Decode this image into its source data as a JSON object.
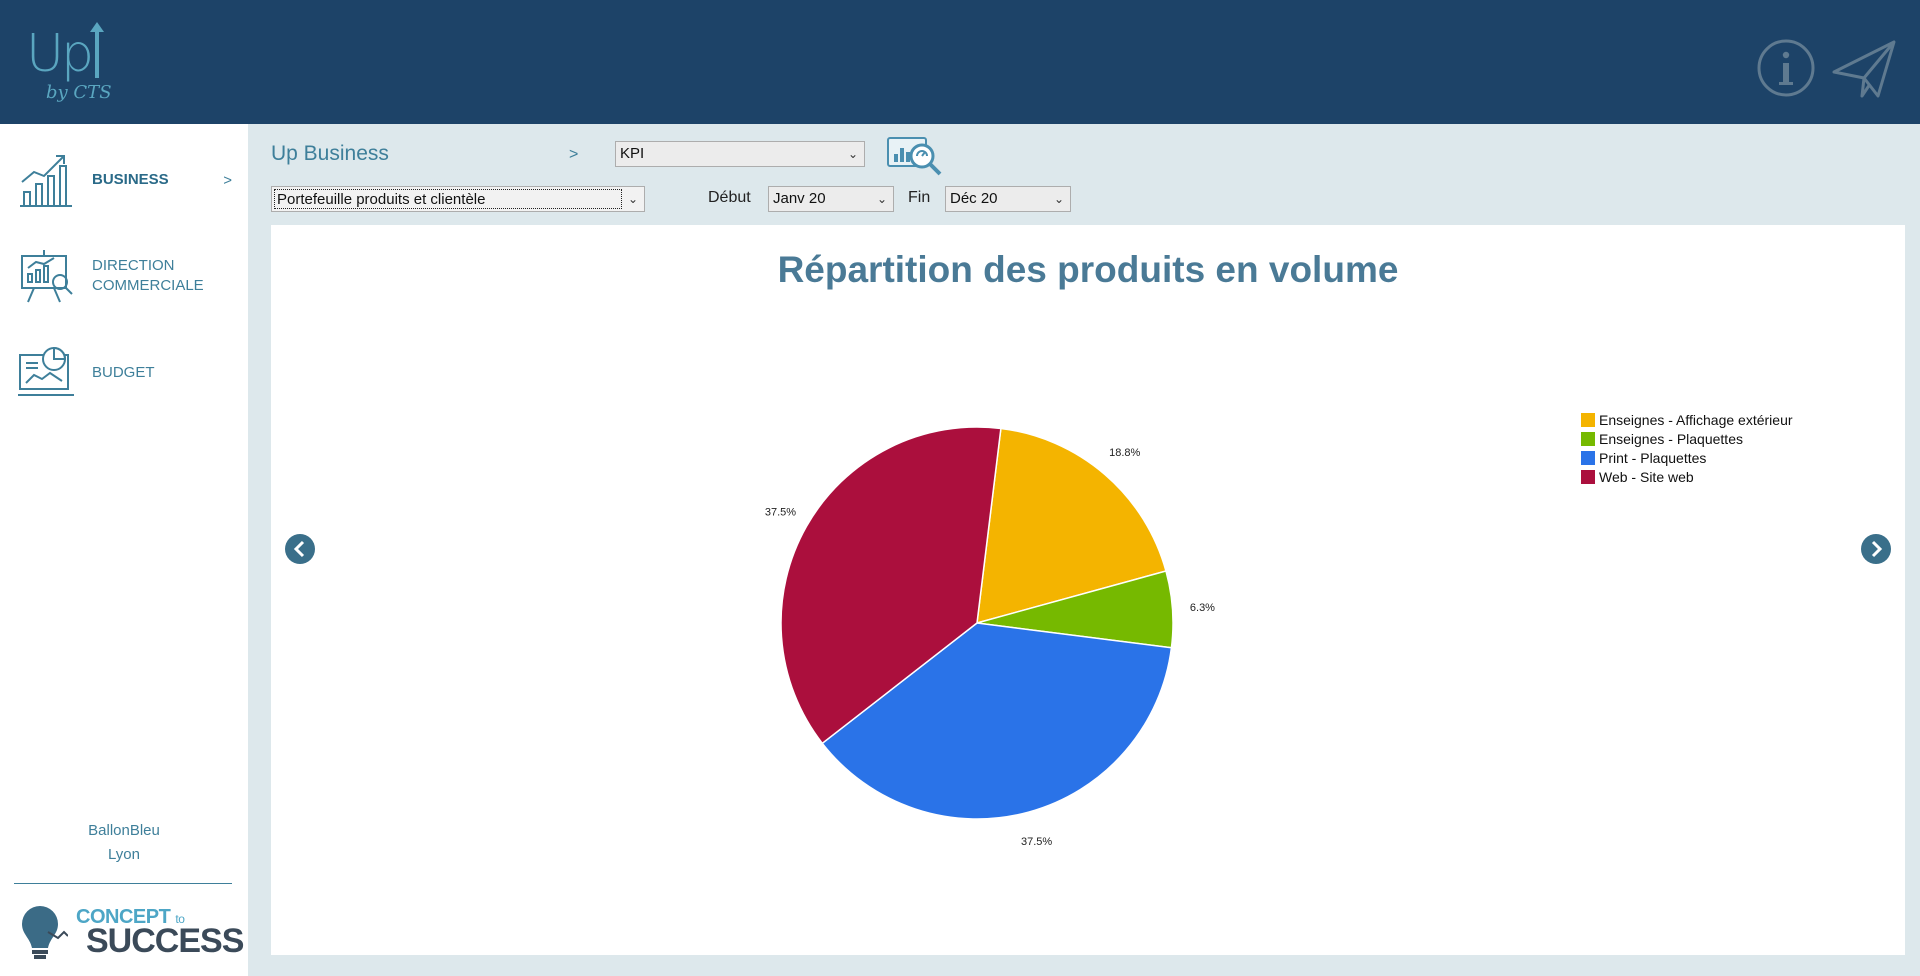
{
  "header": {
    "logo_text": "Up",
    "logo_sub": "by CTS",
    "info_icon": "info-icon",
    "send_icon": "paper-plane-icon"
  },
  "sidebar": {
    "items": [
      {
        "label": "BUSINESS",
        "icon": "line-chart-icon",
        "active": true,
        "chevron": ">"
      },
      {
        "label": "DIRECTION\nCOMMERCIALE",
        "icon": "presentation-analytics-icon",
        "active": false
      },
      {
        "label": "BUDGET",
        "icon": "dashboard-budget-icon",
        "active": false
      }
    ],
    "company_name": "BallonBleu",
    "company_city": "Lyon",
    "footer_logo_line1": "CONCEPT",
    "footer_logo_to": "to",
    "footer_logo_line2": "SUCCESS"
  },
  "toolbar": {
    "breadcrumb": "Up Business",
    "breadcrumb_sep": ">",
    "kpi_select": "KPI",
    "report_select": "Portefeuille produits et clientèle",
    "start_label": "Début",
    "start_value": "Janv 20",
    "end_label": "Fin",
    "end_value": "Déc 20",
    "kpi_button_icon": "magnifier-chart-icon"
  },
  "colors": {
    "topbar": "#1d4368",
    "accent": "#3e7f9a",
    "title": "#4a7a96"
  },
  "chart_data": {
    "type": "pie",
    "title": "Répartition des produits en volume",
    "categories": [
      "Enseignes - Affichage extérieur",
      "Enseignes - Plaquettes",
      "Print - Plaquettes",
      "Web - Site web"
    ],
    "values": [
      18.8,
      6.3,
      37.5,
      37.5
    ],
    "labels": [
      "18.8%",
      "6.3%",
      "37.5%",
      "37.5%"
    ],
    "colors": [
      "#f4b400",
      "#76b900",
      "#2a73e8",
      "#ab0f3d"
    ],
    "legend": "top-right"
  }
}
